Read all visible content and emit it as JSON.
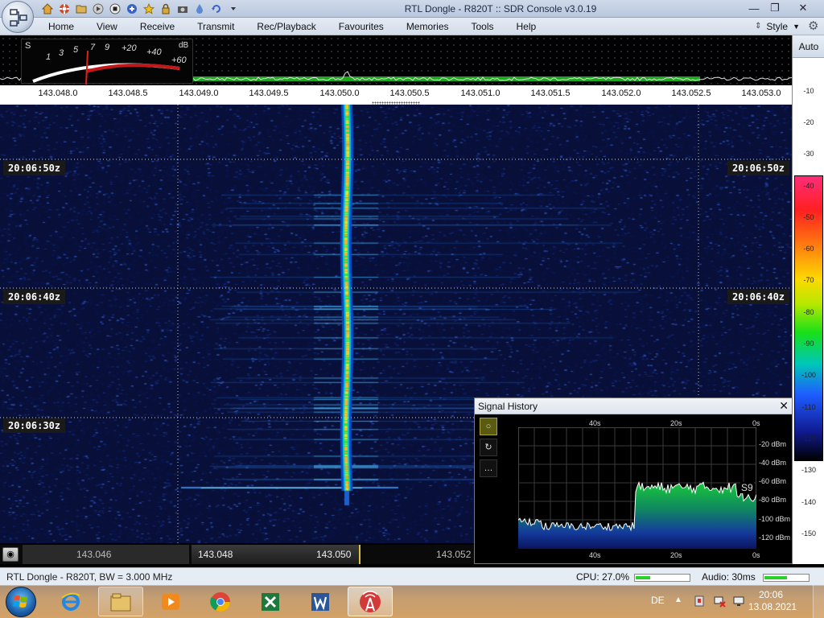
{
  "window": {
    "title": "RTL Dongle - R820T :: SDR Console v3.0.19",
    "minimize_glyph": "—",
    "maximize_glyph": "❐",
    "close_glyph": "✕"
  },
  "quick_access": [
    {
      "icon": "home-icon",
      "color": "#d9a03a"
    },
    {
      "icon": "lifebuoy-icon",
      "color": "#d34a2a"
    },
    {
      "icon": "folder-icon",
      "color": "#d9b25a"
    },
    {
      "icon": "play-icon",
      "color": "#bfbfbf"
    },
    {
      "icon": "stop-icon",
      "color": "#e9e9e9"
    },
    {
      "icon": "add-icon",
      "color": "#3a63c8"
    },
    {
      "icon": "star-icon",
      "color": "#e8b820"
    },
    {
      "icon": "lock-icon",
      "color": "#c89a3a"
    },
    {
      "icon": "camera-icon",
      "color": "#555555"
    },
    {
      "icon": "drop-icon",
      "color": "#5a8ad0"
    },
    {
      "icon": "undo-icon",
      "color": "#3a63c8"
    },
    {
      "icon": "customize-icon",
      "color": "#333333"
    }
  ],
  "menu": {
    "items": [
      "Home",
      "View",
      "Receive",
      "Transmit",
      "Rec/Playback",
      "Favourites",
      "Memories",
      "Tools",
      "Help"
    ],
    "style_label": "Style"
  },
  "smeter": {
    "s_label": "S",
    "db_label": "dB",
    "scale_s": [
      "1",
      "3",
      "5",
      "7",
      "9"
    ],
    "scale_db": [
      "+20",
      "+40",
      "+60"
    ]
  },
  "frequency_axis": [
    "143.048.0",
    "143.048.5",
    "143.049.0",
    "143.049.5",
    "143.050.0",
    "143.050.5",
    "143.051.0",
    "143.051.5",
    "143.052.0",
    "143.052.5",
    "143.053.0"
  ],
  "waterfall": {
    "time_labels": [
      "20:06:50z",
      "20:06:40z",
      "20:06:30z"
    ]
  },
  "db_scale": {
    "auto_label": "Auto",
    "ticks": [
      "-10",
      "-20",
      "-30",
      "-40",
      "-50",
      "-60",
      "-70",
      "-80",
      "-90",
      "-100",
      "-110",
      "-120",
      "-130",
      "-140",
      "-150"
    ]
  },
  "tuning_strip": {
    "labels": [
      "143.046",
      "143.048",
      "143.050",
      "143.052"
    ]
  },
  "signal_history": {
    "title": "Signal History",
    "close_glyph": "✕",
    "buttons": [
      "○",
      "↻",
      "…"
    ],
    "time_labels": [
      "40s",
      "20s",
      "0s"
    ],
    "dbm_labels": [
      "-20 dBm",
      "-40 dBm",
      "-60 dBm",
      "-80 dBm",
      "-100 dBm",
      "-120 dBm"
    ],
    "s_marker": "S9"
  },
  "status": {
    "left_text": "RTL Dongle - R820T, BW = 3.000 MHz",
    "cpu_text": "CPU: 27.0%",
    "cpu_level": 0.27,
    "audio_text": "Audio: 30ms",
    "audio_level": 0.5
  },
  "taskbar": {
    "apps": [
      {
        "icon": "internet-explorer-icon",
        "state": "normal"
      },
      {
        "icon": "file-explorer-icon",
        "state": "pinned"
      },
      {
        "icon": "media-player-icon",
        "state": "normal"
      },
      {
        "icon": "chrome-icon",
        "state": "normal"
      },
      {
        "icon": "excel-icon",
        "state": "normal"
      },
      {
        "icon": "word-icon",
        "state": "normal"
      },
      {
        "icon": "sdr-console-icon",
        "state": "active"
      }
    ],
    "lang": "DE",
    "time": "20:06",
    "date": "13.08.2021"
  }
}
